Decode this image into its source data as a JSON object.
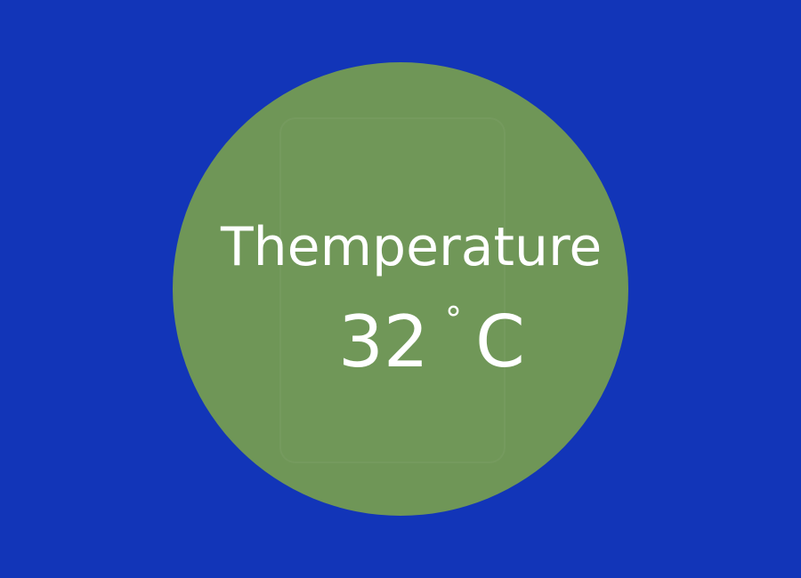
{
  "background_color": "#1235b8",
  "temperature_widget": {
    "circle_color": "#6f9657",
    "text_color": "#ffffff",
    "label": "Themperature",
    "value": "32",
    "degree_symbol": "°",
    "unit": "C"
  }
}
